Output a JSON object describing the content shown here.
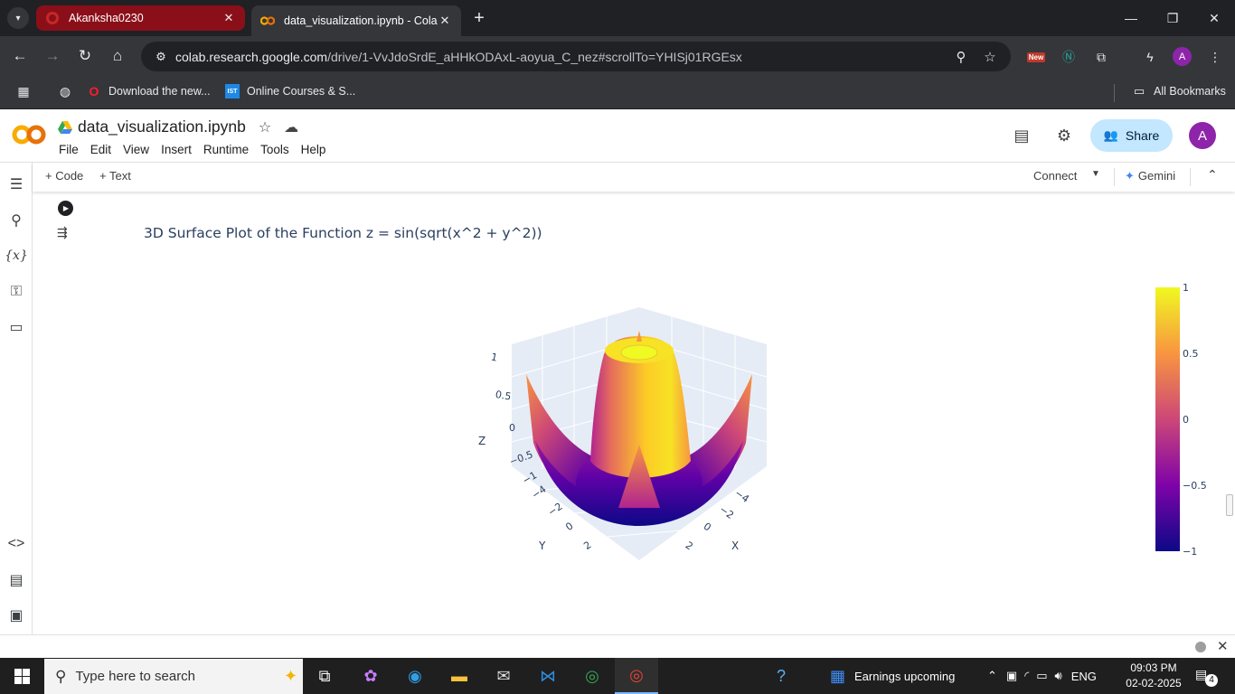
{
  "browser": {
    "tabs": [
      {
        "title": "Akanksha0230",
        "favicon": "github-icon"
      },
      {
        "title": "data_visualization.ipynb - Colab",
        "favicon": "colab-icon",
        "active": true
      }
    ],
    "url_host": "colab.research.google.com",
    "url_path": "/drive/1-VvJdoSrdE_aHHkODAxL-aoyua_C_nez#scrollTo=YHISj01RGEsx",
    "ext_new_badge": "New",
    "profile_initial": "A",
    "bookmarks": [
      {
        "label": "Download the new...",
        "icon": "opera-icon"
      },
      {
        "label": "Online Courses & S...",
        "icon": "ist-icon",
        "badge": "IST"
      }
    ],
    "all_bookmarks": "All Bookmarks"
  },
  "colab": {
    "logo": "CO",
    "notebook_title": "data_visualization.ipynb",
    "menu": [
      "File",
      "Edit",
      "View",
      "Insert",
      "Runtime",
      "Tools",
      "Help"
    ],
    "share_label": "Share",
    "avatar_initial": "A",
    "toolbar": {
      "add_code": "+ Code",
      "add_text": "+ Text",
      "connect": "Connect",
      "gemini": "Gemini"
    }
  },
  "output": {
    "plot_title": "3D Surface Plot of the Function z = sin(sqrt(x^2 + y^2))"
  },
  "chart_data": {
    "type": "surface",
    "title": "3D Surface Plot of the Function z = sin(sqrt(x^2 + y^2))",
    "function": "z = sin(sqrt(x^2 + y^2))",
    "x_axis": {
      "label": "X",
      "ticks": [
        "−4",
        "−2",
        "0",
        "2"
      ]
    },
    "y_axis": {
      "label": "Y",
      "ticks": [
        "−4",
        "−2",
        "0",
        "2"
      ]
    },
    "z_axis": {
      "label": "Z",
      "ticks": [
        "−1",
        "−0.5",
        "0",
        "0.5",
        "1"
      ]
    },
    "colorscale": "Plasma",
    "colorbar": {
      "ticks": [
        "1",
        "0.5",
        "0",
        "−0.5",
        "−1"
      ],
      "range": [
        -1,
        1
      ]
    },
    "colors": {
      "min": "#0d0887",
      "mid": "#cc4778",
      "max": "#f0f921"
    }
  },
  "taskbar": {
    "search_placeholder": "Type here to search",
    "weather_label": "Earnings upcoming",
    "language": "ENG",
    "time": "09:03 PM",
    "date": "02-02-2025",
    "notifications": "4"
  }
}
